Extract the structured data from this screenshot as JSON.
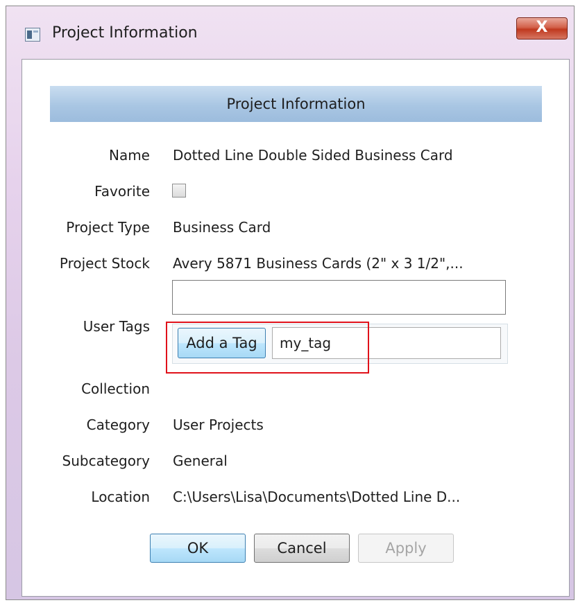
{
  "window": {
    "title": "Project Information",
    "close_label": "X",
    "accent_close": "#c7442b"
  },
  "header": {
    "title": "Project Information"
  },
  "fields": {
    "name_label": "Name",
    "name_value": "Dotted Line Double Sided Business Card",
    "favorite_label": "Favorite",
    "favorite_checked": false,
    "project_type_label": "Project Type",
    "project_type_value": "Business Card",
    "project_stock_label": "Project Stock",
    "project_stock_value": "Avery 5871 Business Cards (2\" x 3 1/2\",...",
    "user_tags_label": "User Tags",
    "user_tags_value": "",
    "collection_label": "Collection",
    "collection_value": "",
    "category_label": "Category",
    "category_value": "User Projects",
    "subcategory_label": "Subcategory",
    "subcategory_value": "General",
    "location_label": "Location",
    "location_value": "C:\\Users\\Lisa\\Documents\\Dotted Line D..."
  },
  "tag_entry": {
    "button_label": "Add a Tag",
    "value": "my_tag"
  },
  "buttons": {
    "ok": "OK",
    "cancel": "Cancel",
    "apply": "Apply"
  },
  "colors": {
    "header_band": "#a9c6e3",
    "highlight": "#e0111a",
    "disabled_text": "#a5a5a5"
  }
}
